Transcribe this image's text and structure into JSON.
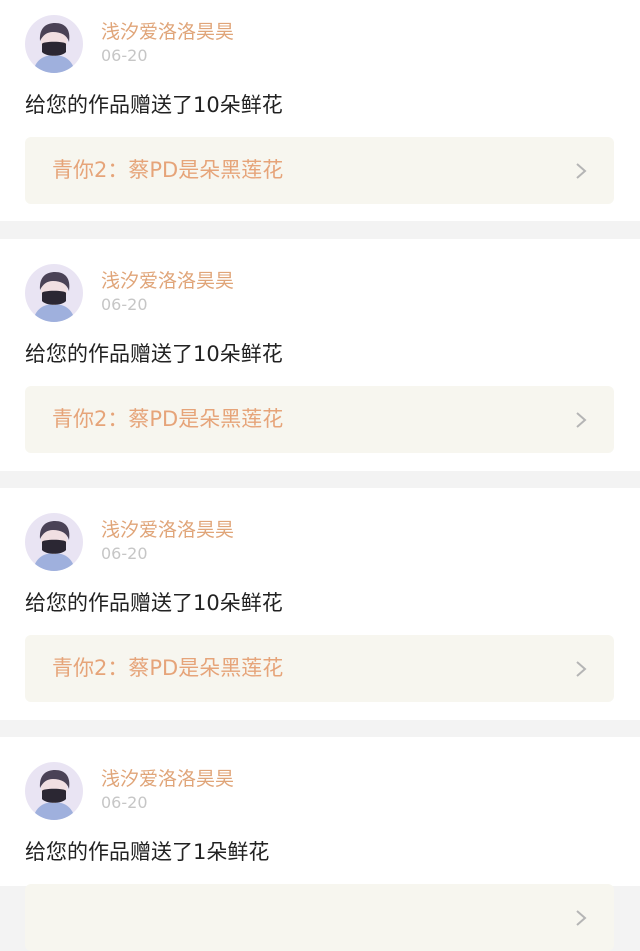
{
  "feed": {
    "items": [
      {
        "username": "浅汐爱洛洛昊昊",
        "date": "06-20",
        "message": "给您的作品赠送了10朵鲜花",
        "work_title": "青你2：蔡PD是朵黑莲花"
      },
      {
        "username": "浅汐爱洛洛昊昊",
        "date": "06-20",
        "message": "给您的作品赠送了10朵鲜花",
        "work_title": "青你2：蔡PD是朵黑莲花"
      },
      {
        "username": "浅汐爱洛洛昊昊",
        "date": "06-20",
        "message": "给您的作品赠送了10朵鲜花",
        "work_title": "青你2：蔡PD是朵黑莲花"
      },
      {
        "username": "浅汐爱洛洛昊昊",
        "date": "06-20",
        "message": "给您的作品赠送了1朵鲜花",
        "work_title": ""
      }
    ]
  },
  "icons": {
    "chevron": "chevron-right-icon",
    "avatar": "user-avatar"
  },
  "colors": {
    "accent": "#e0a579",
    "card_link_bg": "#f7f6ef",
    "page_bg": "#f3f3f3"
  }
}
